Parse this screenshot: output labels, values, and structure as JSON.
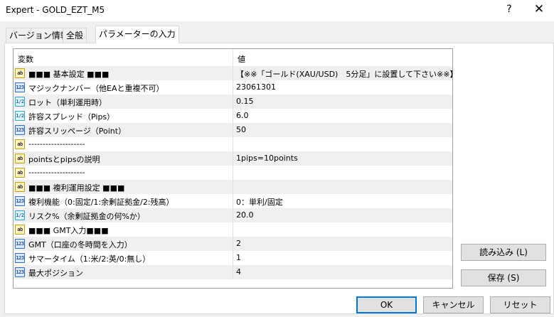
{
  "window": {
    "title": "Expert - GOLD_EZT_M5",
    "help_label": "?",
    "close_label": "✕"
  },
  "tabs": [
    {
      "label": "バージョン情報"
    },
    {
      "label": "全般"
    },
    {
      "label": "パラメーターの入力"
    }
  ],
  "active_tab": 2,
  "grid": {
    "headers": {
      "variable": "変数",
      "value": "値"
    },
    "rows": [
      {
        "icon": "ab",
        "name": "■■■ 基本設定 ■■■",
        "value": "【※※「ゴールド(XAU/USD)　5分足」に設置して下さい※※】"
      },
      {
        "icon": "123",
        "name": "マジックナンバー（他EAと重複不可）",
        "value": "23061301"
      },
      {
        "icon": "1/2",
        "name": "ロット（単利運用時）",
        "value": "0.15"
      },
      {
        "icon": "1/2",
        "name": "許容スプレッド（Pips）",
        "value": "6.0"
      },
      {
        "icon": "123",
        "name": "許容スリッページ（Point）",
        "value": "50"
      },
      {
        "icon": "ab",
        "name": "--------------------",
        "value": ""
      },
      {
        "icon": "ab",
        "name": "pointsとpipsの説明",
        "value": "1pips=10points"
      },
      {
        "icon": "ab",
        "name": "--------------------",
        "value": ""
      },
      {
        "icon": "ab",
        "name": "■■■ 複利運用設定 ■■■",
        "value": ""
      },
      {
        "icon": "123",
        "name": "複利機能（0:固定/1:余剰証拠金/2:残高）",
        "value": "0：単利/固定"
      },
      {
        "icon": "1/2",
        "name": "リスク%（余剰証拠金の何%か）",
        "value": "20.0"
      },
      {
        "icon": "ab",
        "name": "■■■ GMT入力■■■",
        "value": ""
      },
      {
        "icon": "123",
        "name": "GMT（口座の冬時間を入力）",
        "value": "2"
      },
      {
        "icon": "123",
        "name": "サマータイム（1:米/2:英/0:無し）",
        "value": "1"
      },
      {
        "icon": "123",
        "name": "最大ポジション",
        "value": "4"
      }
    ]
  },
  "side_buttons": {
    "load": "読み込み (L)",
    "save": "保存 (S)"
  },
  "bottom_buttons": {
    "ok": "OK",
    "cancel": "キャンセル",
    "reset": "リセット"
  }
}
